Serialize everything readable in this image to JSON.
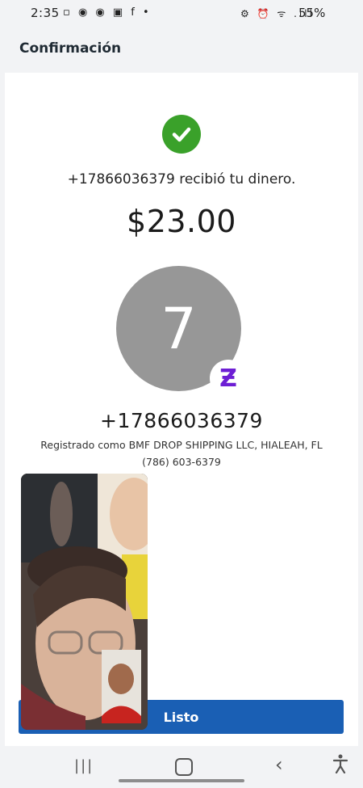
{
  "status_bar": {
    "time": "2:35",
    "left_icons": "▫ ◉ ◉ ▣ f •",
    "right_icons": "⚙ ⏰ ᯤ .ıll",
    "battery": "55%"
  },
  "header": {
    "title": "Confirmación"
  },
  "confirmation": {
    "message": "+17866036379 recibió tu dinero.",
    "amount": "$23.00",
    "avatar_initial": "7",
    "badge_glyph": "Ƶ",
    "recipient_phone": "+17866036379",
    "registered_as": "Registrado como BMF DROP SHIPPING LLC, HIALEAH, FL",
    "formatted_phone": "(786) 603-6379"
  },
  "actions": {
    "done_label": "Listo"
  },
  "colors": {
    "success": "#3aa12a",
    "primary_button": "#1a5fb4",
    "zelle_purple": "#6d1ed4",
    "avatar_gray": "#979797"
  },
  "icons": [
    "check-icon",
    "zelle-icon",
    "recent-apps-icon",
    "home-icon",
    "back-icon",
    "accessibility-icon"
  ]
}
